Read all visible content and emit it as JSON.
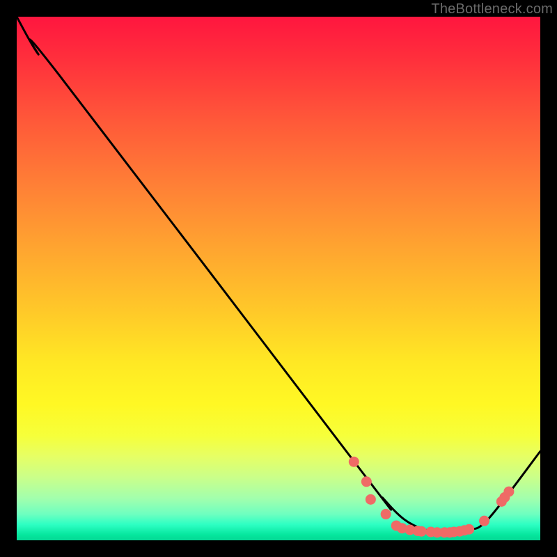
{
  "watermark": "TheBottleneck.com",
  "chart_data": {
    "type": "line",
    "title": "",
    "xlabel": "",
    "ylabel": "",
    "xlim": [
      0,
      100
    ],
    "ylim": [
      0,
      100
    ],
    "grid": false,
    "legend": false,
    "series": [
      {
        "name": "curve",
        "x": [
          0,
          4,
          8,
          66,
          70,
          74,
          78,
          82,
          86,
          90,
          100
        ],
        "y": [
          100,
          93,
          89,
          13,
          8,
          4,
          2,
          1.5,
          2,
          4,
          17
        ]
      }
    ],
    "markers": {
      "name": "dots",
      "color": "#ef6a66",
      "points": [
        {
          "x": 64.4,
          "y": 15.0
        },
        {
          "x": 66.8,
          "y": 11.2
        },
        {
          "x": 67.6,
          "y": 7.8
        },
        {
          "x": 70.5,
          "y": 5.0
        },
        {
          "x": 72.5,
          "y": 2.8
        },
        {
          "x": 73.6,
          "y": 2.3
        },
        {
          "x": 75.1,
          "y": 2.0
        },
        {
          "x": 76.6,
          "y": 1.8
        },
        {
          "x": 77.3,
          "y": 1.7
        },
        {
          "x": 79.1,
          "y": 1.6
        },
        {
          "x": 80.3,
          "y": 1.5
        },
        {
          "x": 81.7,
          "y": 1.5
        },
        {
          "x": 82.7,
          "y": 1.5
        },
        {
          "x": 83.5,
          "y": 1.6
        },
        {
          "x": 84.6,
          "y": 1.7
        },
        {
          "x": 85.5,
          "y": 1.9
        },
        {
          "x": 86.4,
          "y": 2.1
        },
        {
          "x": 89.3,
          "y": 3.7
        },
        {
          "x": 92.6,
          "y": 7.4
        },
        {
          "x": 93.2,
          "y": 8.2
        },
        {
          "x": 94.0,
          "y": 9.3
        }
      ]
    },
    "background_gradient": {
      "direction": "top-to-bottom",
      "stops": [
        {
          "pos": 0,
          "color": "#ff163f"
        },
        {
          "pos": 20,
          "color": "#ff5939"
        },
        {
          "pos": 44,
          "color": "#ffa430"
        },
        {
          "pos": 66,
          "color": "#ffe824"
        },
        {
          "pos": 84,
          "color": "#e6ff65"
        },
        {
          "pos": 95,
          "color": "#6effc0"
        },
        {
          "pos": 100,
          "color": "#05d894"
        }
      ]
    }
  }
}
